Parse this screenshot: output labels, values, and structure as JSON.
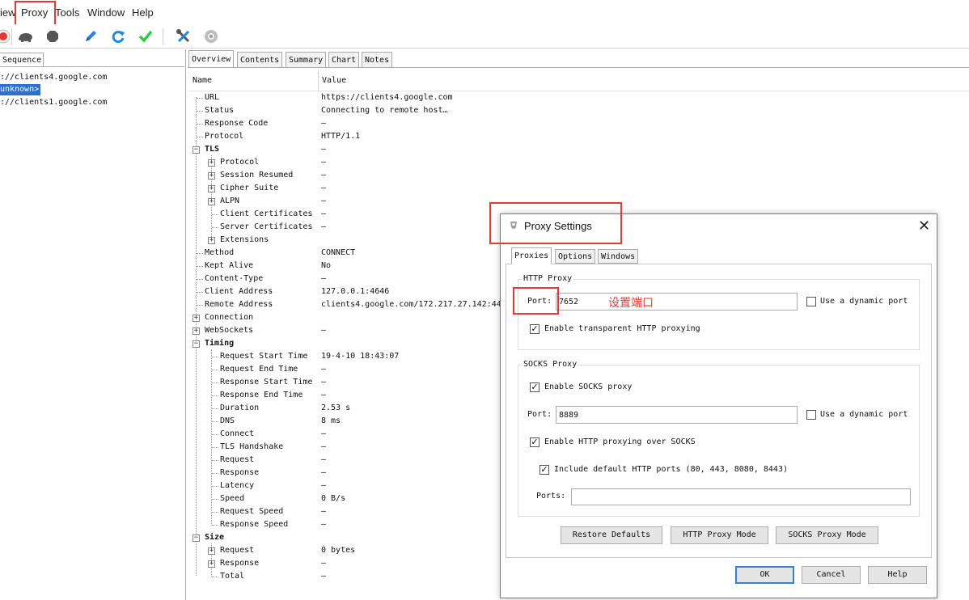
{
  "menu": {
    "items": [
      "iew",
      "Proxy",
      "Tools",
      "Window",
      "Help"
    ]
  },
  "toolbar": {
    "buttons": [
      "record-icon",
      "turtle-icon",
      "stop-icon",
      "pen-icon",
      "refresh-icon",
      "check-icon",
      "tools-icon",
      "gear-icon"
    ]
  },
  "left_pane": {
    "tab_label": "Sequence",
    "items": [
      {
        "text": "://clients4.google.com",
        "selected": false
      },
      {
        "text": "unknown>",
        "selected": true
      },
      {
        "text": "://clients1.google.com",
        "selected": false
      }
    ]
  },
  "tabs": [
    "Overview",
    "Contents",
    "Summary",
    "Chart",
    "Notes"
  ],
  "overview": {
    "header_name": "Name",
    "header_value": "Value",
    "rows": [
      {
        "name": "URL",
        "value": "https://clients4.google.com"
      },
      {
        "name": "Status",
        "value": "Connecting to remote host…"
      },
      {
        "name": "Response Code",
        "value": "–"
      },
      {
        "name": "Protocol",
        "value": "HTTP/1.1"
      },
      {
        "name": "TLS",
        "value": "–"
      },
      {
        "name": "Protocol",
        "value": "–"
      },
      {
        "name": "Session Resumed",
        "value": "–"
      },
      {
        "name": "Cipher Suite",
        "value": "–"
      },
      {
        "name": "ALPN",
        "value": "–"
      },
      {
        "name": "Client Certificates",
        "value": "–"
      },
      {
        "name": "Server Certificates",
        "value": "–"
      },
      {
        "name": "Extensions",
        "value": ""
      },
      {
        "name": "Method",
        "value": "CONNECT"
      },
      {
        "name": "Kept Alive",
        "value": "No"
      },
      {
        "name": "Content-Type",
        "value": "–"
      },
      {
        "name": "Client Address",
        "value": "127.0.0.1:4646"
      },
      {
        "name": "Remote Address",
        "value": "clients4.google.com/172.217.27.142:44"
      },
      {
        "name": "Connection",
        "value": ""
      },
      {
        "name": "WebSockets",
        "value": "–"
      },
      {
        "name": "Timing",
        "value": ""
      },
      {
        "name": "Request Start Time",
        "value": "19-4-10 18:43:07"
      },
      {
        "name": "Request End Time",
        "value": "–"
      },
      {
        "name": "Response Start Time",
        "value": "–"
      },
      {
        "name": "Response End Time",
        "value": "–"
      },
      {
        "name": "Duration",
        "value": "2.53 s"
      },
      {
        "name": "DNS",
        "value": "8 ms"
      },
      {
        "name": "Connect",
        "value": "–"
      },
      {
        "name": "TLS Handshake",
        "value": "–"
      },
      {
        "name": "Request",
        "value": "–"
      },
      {
        "name": "Response",
        "value": "–"
      },
      {
        "name": "Latency",
        "value": "–"
      },
      {
        "name": "Speed",
        "value": "0 B/s"
      },
      {
        "name": "Request Speed",
        "value": "–"
      },
      {
        "name": "Response Speed",
        "value": "–"
      },
      {
        "name": "Size",
        "value": ""
      },
      {
        "name": "Request",
        "value": "0 bytes"
      },
      {
        "name": "Response",
        "value": "–"
      },
      {
        "name": "Total",
        "value": "–"
      }
    ]
  },
  "dialog": {
    "title": "Proxy Settings",
    "tabs": [
      "Proxies",
      "Options",
      "Windows"
    ],
    "http_group": "HTTP Proxy",
    "http_port_label": "Port:",
    "http_port_value": "7652",
    "annotation": "设置端口",
    "http_dynamic_label": "Use a dynamic port",
    "http_dynamic_checked": false,
    "transparent_label": "Enable transparent HTTP proxying",
    "transparent_checked": true,
    "socks_group": "SOCKS Proxy",
    "socks_enable_label": "Enable SOCKS proxy",
    "socks_enable_checked": true,
    "socks_port_label": "Port:",
    "socks_port_value": "8889",
    "socks_dynamic_label": "Use a dynamic port",
    "socks_dynamic_checked": false,
    "http_over_socks_label": "Enable HTTP proxying over SOCKS",
    "http_over_socks_checked": true,
    "default_ports_label": "Include default HTTP ports (80, 443, 8080, 8443)",
    "default_ports_checked": true,
    "ports_label": "Ports:",
    "ports_value": "",
    "restore_label": "Restore Defaults",
    "http_mode_label": "HTTP Proxy Mode",
    "socks_mode_label": "SOCKS Proxy Mode",
    "ok_label": "OK",
    "cancel_label": "Cancel",
    "help_label": "Help"
  },
  "colors": {
    "highlight_red": "#e53935",
    "selection_blue": "#2a6fd6"
  }
}
